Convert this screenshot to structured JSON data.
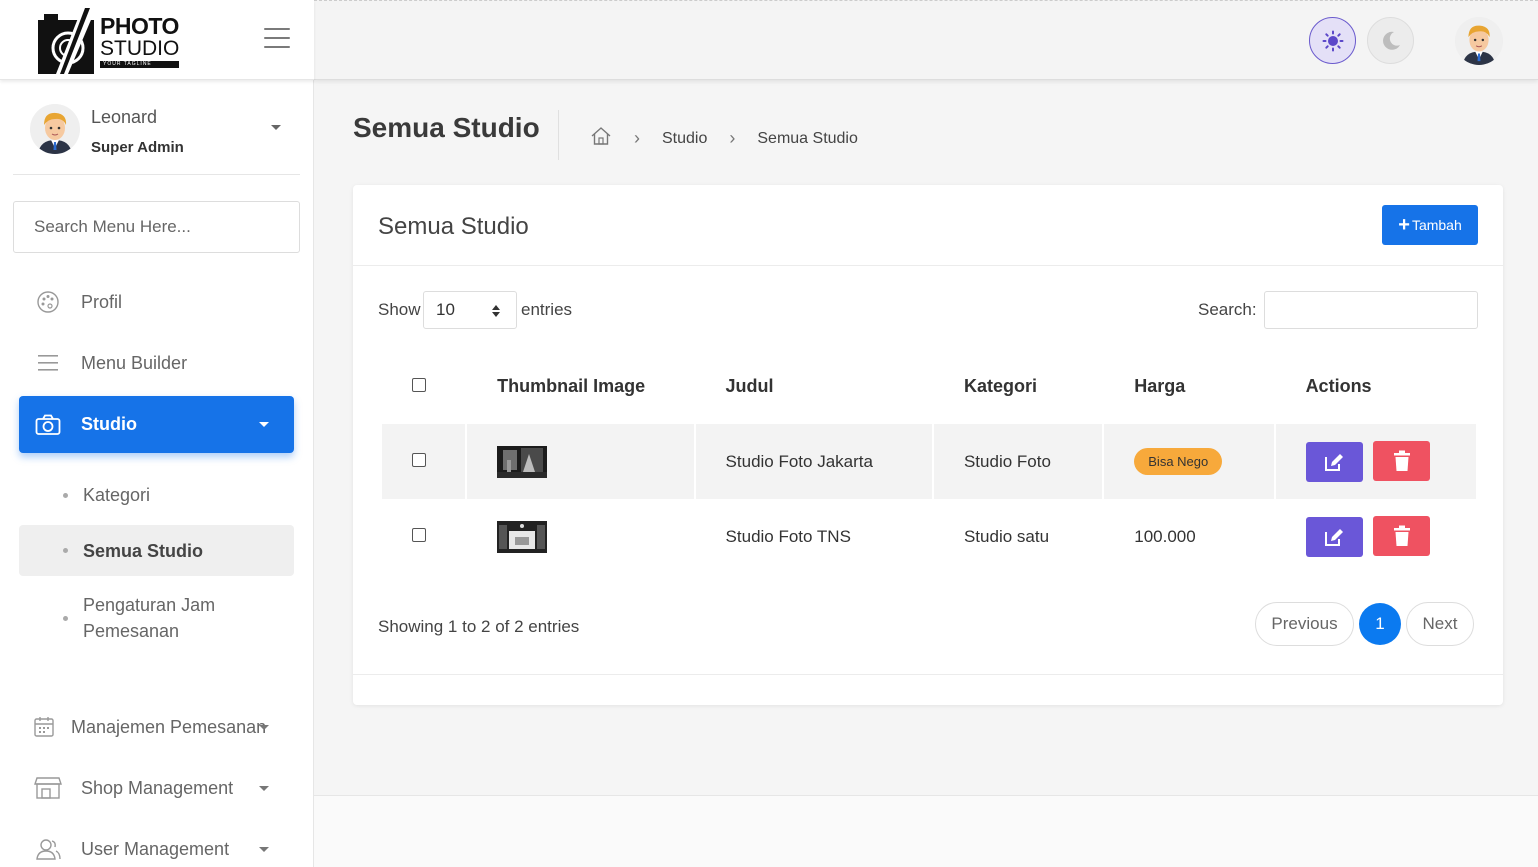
{
  "logo": {
    "line1": "PHOTO",
    "line2": "STUDIO",
    "tagline": "YOUR TAGLINE"
  },
  "user": {
    "name": "Leonard",
    "role": "Super Admin"
  },
  "menu_search": {
    "placeholder": "Search Menu Here..."
  },
  "menu": {
    "profil": "Profil",
    "menu_builder": "Menu Builder",
    "studio": "Studio",
    "studio_sub": {
      "kategori": "Kategori",
      "semua_studio": "Semua Studio",
      "pengaturan_line1": "Pengaturan Jam",
      "pengaturan_line2": "Pemesanan"
    },
    "manajemen_pemesanan": "Manajemen Pemesanan",
    "shop_management": "Shop Management",
    "user_management": "User Management"
  },
  "page": {
    "title": "Semua Studio"
  },
  "breadcrumb": {
    "items": [
      "Studio",
      "Semua Studio"
    ]
  },
  "card": {
    "title": "Semua Studio",
    "add_label": "Tambah"
  },
  "table_controls": {
    "show_label": "Show",
    "page_size": "10",
    "entries_label": "entries",
    "search_label": "Search:"
  },
  "table": {
    "headers": {
      "thumbnail": "Thumbnail Image",
      "judul": "Judul",
      "kategori": "Kategori",
      "harga": "Harga",
      "actions": "Actions"
    },
    "rows": [
      {
        "judul": "Studio Foto Jakarta",
        "kategori": "Studio Foto",
        "harga": "Bisa Nego",
        "harga_is_badge": true
      },
      {
        "judul": "Studio Foto TNS",
        "kategori": "Studio satu",
        "harga": "100.000",
        "harga_is_badge": false
      }
    ]
  },
  "pagination": {
    "info": "Showing 1 to 2 of 2 entries",
    "previous": "Previous",
    "current": "1",
    "next": "Next"
  },
  "colors": {
    "primary": "#1673e8",
    "edit": "#6a57d8",
    "delete": "#ef5261",
    "badge": "#f7a93b",
    "page_active": "#0b7af0"
  }
}
